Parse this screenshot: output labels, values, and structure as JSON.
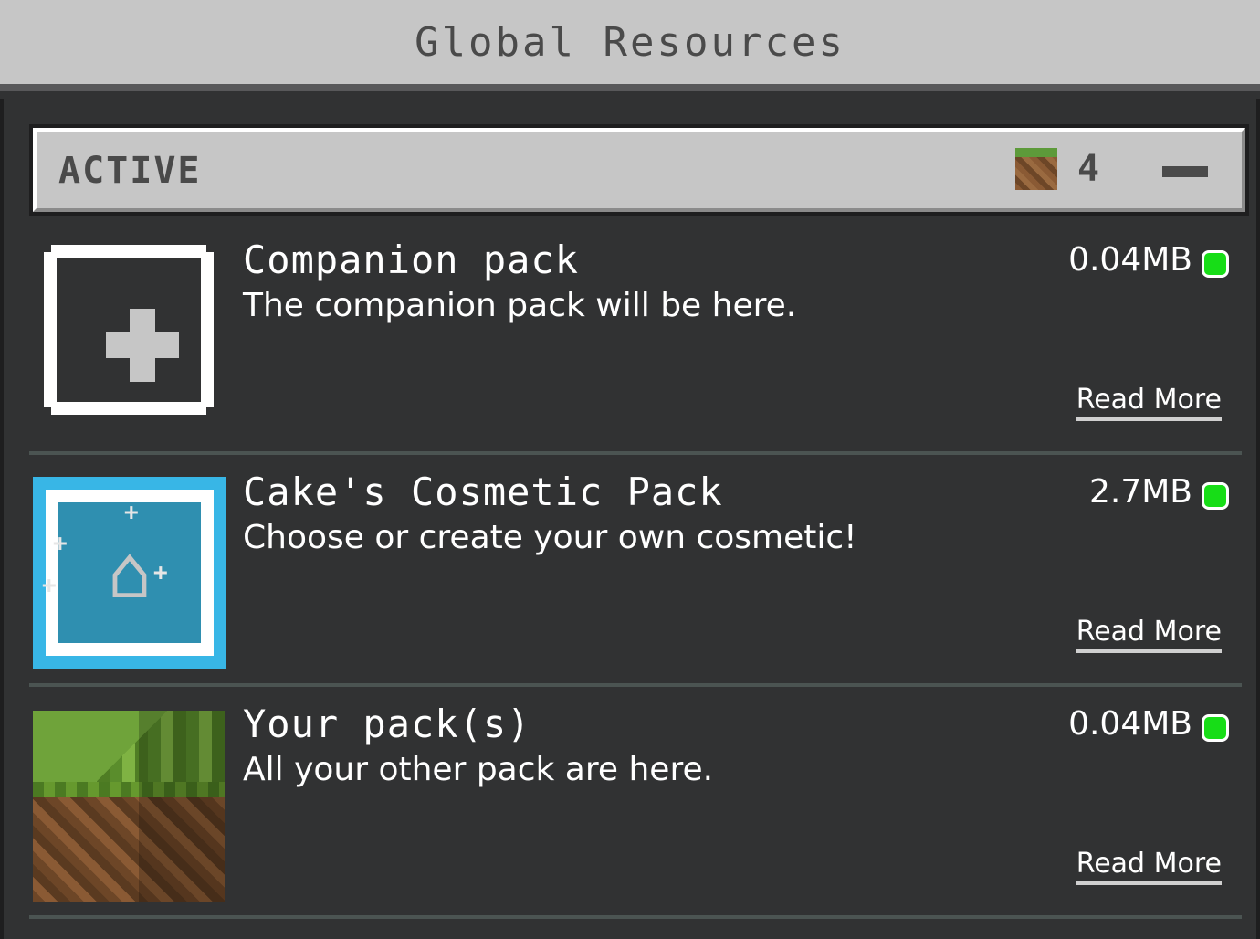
{
  "titlebar": {
    "title": "Global Resources"
  },
  "section": {
    "title": "ACTIVE",
    "count": "4",
    "icon": "grass-block-icon",
    "collapse_icon": "minus-icon"
  },
  "packs": [
    {
      "name": "Companion pack",
      "description": "The companion pack will be here.",
      "size": "0.04MB",
      "read_more": "Read More",
      "icon": "plus-icon",
      "status_color": "#17dd17"
    },
    {
      "name": "Cake's Cosmetic Pack",
      "description": "Choose or create your own cosmetic!",
      "size": "2.7MB",
      "read_more": "Read More",
      "icon": "hanger-icon",
      "status_color": "#17dd17"
    },
    {
      "name": "Your pack(s)",
      "description": "All your other pack are here.",
      "size": "0.04MB",
      "read_more": "Read More",
      "icon": "grass-block-icon",
      "status_color": "#17dd17"
    }
  ],
  "colors": {
    "background": "#313233",
    "header_bg": "#c6c6c6",
    "active_green": "#17dd17"
  }
}
